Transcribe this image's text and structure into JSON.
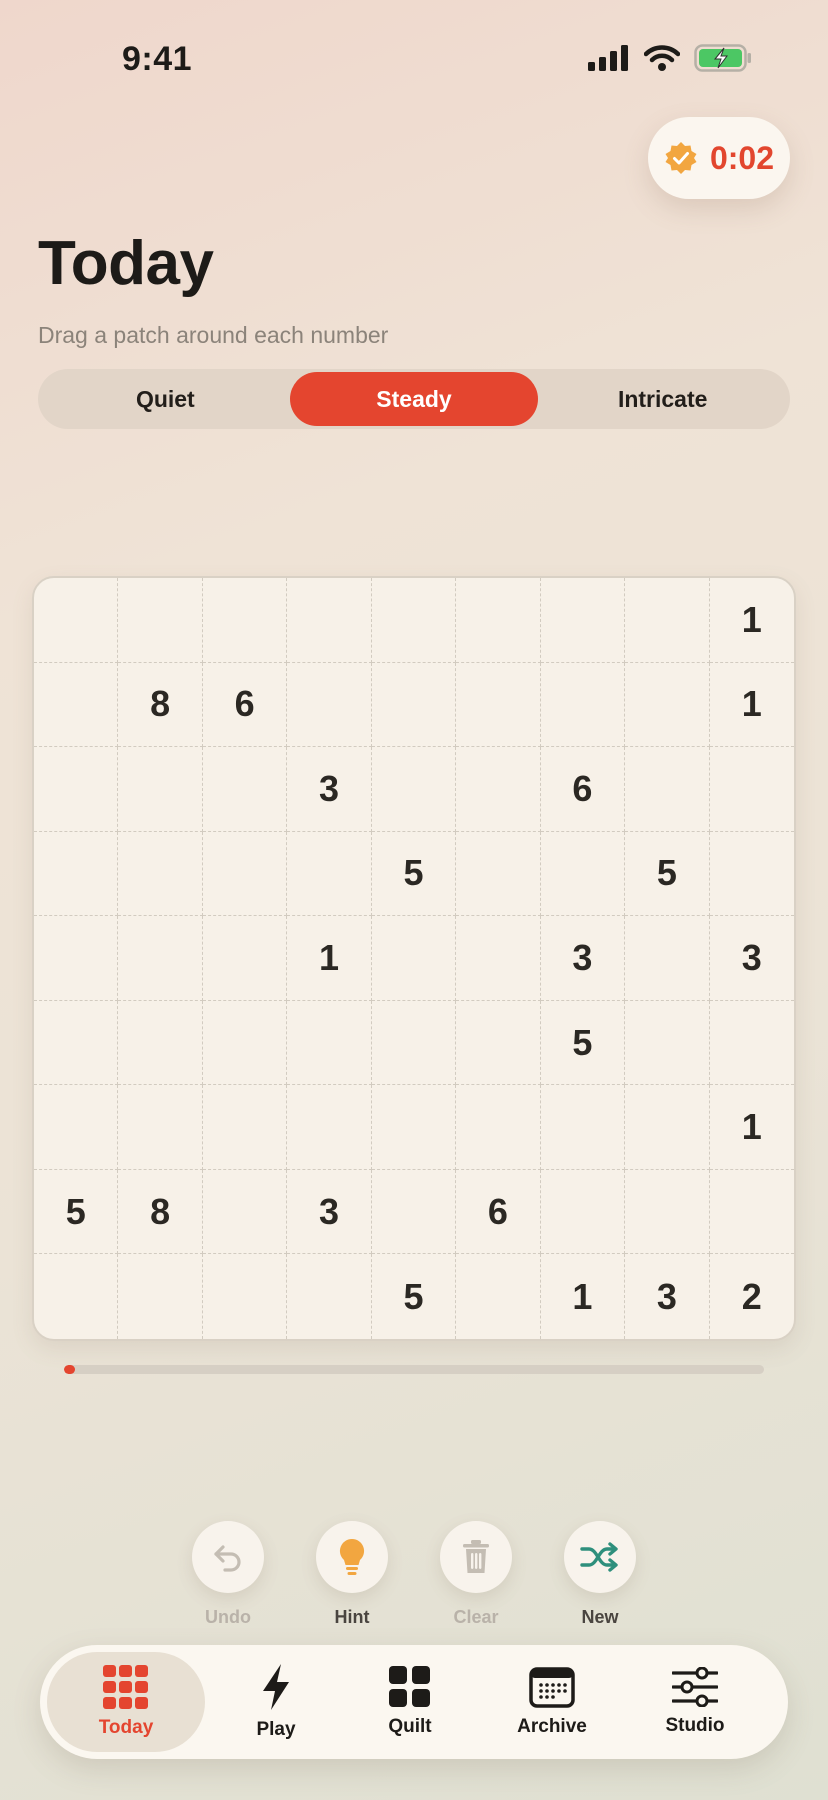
{
  "status_bar": {
    "time": "9:41"
  },
  "timer": {
    "value": "0:02",
    "badge_icon": "verified-badge-icon"
  },
  "header": {
    "title": "Today",
    "subtitle": "Drag a patch around each number"
  },
  "difficulty": {
    "options": [
      "Quiet",
      "Steady",
      "Intricate"
    ],
    "selected": "Steady"
  },
  "board": {
    "size": 9,
    "rows": [
      [
        "",
        "",
        "",
        "",
        "",
        "",
        "",
        "",
        "1"
      ],
      [
        "",
        "8",
        "6",
        "",
        "",
        "",
        "",
        "",
        "1"
      ],
      [
        "",
        "",
        "",
        "3",
        "",
        "",
        "6",
        "",
        ""
      ],
      [
        "",
        "",
        "",
        "",
        "5",
        "",
        "",
        "5",
        ""
      ],
      [
        "",
        "",
        "",
        "1",
        "",
        "",
        "3",
        "",
        "3"
      ],
      [
        "",
        "",
        "",
        "",
        "",
        "",
        "5",
        "",
        ""
      ],
      [
        "",
        "",
        "",
        "",
        "",
        "",
        "",
        "",
        "1"
      ],
      [
        "5",
        "8",
        "",
        "3",
        "",
        "6",
        "",
        "",
        ""
      ],
      [
        "",
        "",
        "",
        "",
        "5",
        "",
        "1",
        "3",
        "2"
      ]
    ]
  },
  "progress": {
    "fraction": 0.01
  },
  "actions": [
    {
      "label": "Undo",
      "icon": "undo-icon",
      "enabled": false
    },
    {
      "label": "Hint",
      "icon": "lightbulb-icon",
      "enabled": true
    },
    {
      "label": "Clear",
      "icon": "trash-icon",
      "enabled": false
    },
    {
      "label": "New",
      "icon": "shuffle-icon",
      "enabled": true
    }
  ],
  "tabs": [
    {
      "label": "Today",
      "icon": "grid-icon",
      "active": true
    },
    {
      "label": "Play",
      "icon": "bolt-icon",
      "active": false
    },
    {
      "label": "Quilt",
      "icon": "quilt-squares-icon",
      "active": false
    },
    {
      "label": "Archive",
      "icon": "calendar-icon",
      "active": false
    },
    {
      "label": "Studio",
      "icon": "sliders-icon",
      "active": false
    }
  ],
  "colors": {
    "accent": "#e4452f",
    "badge": "#f2a640",
    "shuffle": "#2e8f7c",
    "battery": "#4cc764"
  }
}
